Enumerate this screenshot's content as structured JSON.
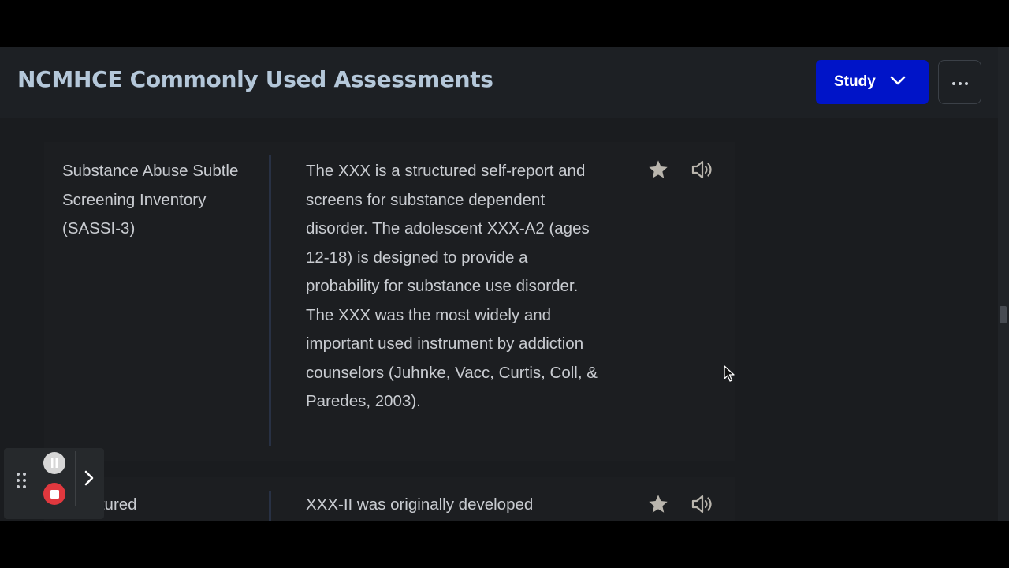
{
  "header": {
    "title": "NCMHCE Commonly Used Assessments",
    "study_button": {
      "label": "Study",
      "icon": "chevron-down-icon"
    },
    "more_button": {
      "icon": "ellipsis-icon"
    }
  },
  "cards": [
    {
      "term": "Substance Abuse Subtle Screening Inventory (SASSI-3)",
      "definition": "The XXX is a structured self-report and screens for substance dependent disorder. The adolescent XXX-A2 (ages 12-18) is designed to provide a probability for substance use disorder. The XXX was the most widely and important used instrument by addiction counselors (Juhnke, Vacc, Curtis, Coll, & Paredes, 2003).",
      "starred": true
    },
    {
      "term": "Structured",
      "definition": "XXX-II was originally developed",
      "starred": true
    }
  ],
  "colors": {
    "accent": "#0014c8",
    "title": "#b4c7d9",
    "text": "#c9ccd1",
    "star": "#b9b5ad",
    "stop": "#e0383e"
  },
  "recorder": {
    "icons": [
      "drag-grip-icon",
      "pause-icon",
      "stop-icon",
      "chevron-right-icon"
    ]
  }
}
